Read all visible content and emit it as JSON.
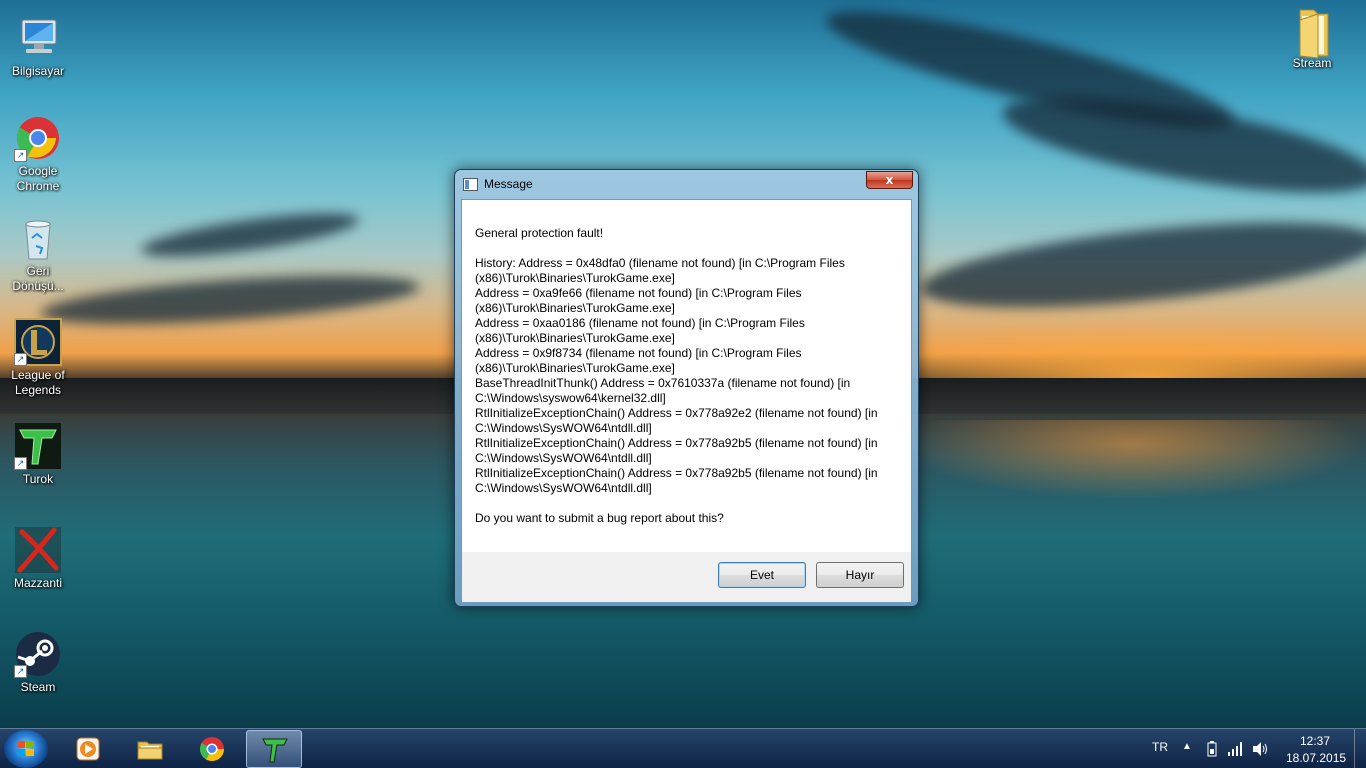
{
  "desktop": {
    "icons_left": [
      {
        "label": "Bilgisayar",
        "icon": "computer-icon"
      },
      {
        "label": "Google Chrome",
        "icon": "chrome-icon"
      },
      {
        "label": "Geri Dönüşü...",
        "icon": "recycle-bin-icon"
      },
      {
        "label": "League of Legends",
        "icon": "league-of-legends-icon"
      },
      {
        "label": "Turok",
        "icon": "turok-icon"
      },
      {
        "label": "Mazzanti",
        "icon": "mazzanti-icon"
      },
      {
        "label": "Steam",
        "icon": "steam-icon"
      }
    ],
    "icons_right": [
      {
        "label": "Stream",
        "icon": "folder-icon"
      }
    ]
  },
  "dialog": {
    "title": "Message",
    "close_label": "x",
    "message_lines": [
      "General protection fault!",
      "",
      "History: Address = 0x48dfa0   (filename not found) [in C:\\Program Files",
      "(x86)\\Turok\\Binaries\\TurokGame.exe]",
      "Address = 0xa9fe66   (filename not found) [in C:\\Program Files",
      "(x86)\\Turok\\Binaries\\TurokGame.exe]",
      "Address = 0xaa0186   (filename not found) [in C:\\Program Files",
      "(x86)\\Turok\\Binaries\\TurokGame.exe]",
      "Address = 0x9f8734   (filename not found) [in C:\\Program Files",
      "(x86)\\Turok\\Binaries\\TurokGame.exe]",
      "BaseThreadInitThunk() Address = 0x7610337a (filename not found) [in",
      "C:\\Windows\\syswow64\\kernel32.dll]",
      "RtlInitializeExceptionChain() Address = 0x778a92e2 (filename not found) [in",
      "C:\\Windows\\SysWOW64\\ntdll.dll]",
      "RtlInitializeExceptionChain() Address = 0x778a92b5 (filename not found) [in",
      "C:\\Windows\\SysWOW64\\ntdll.dll]",
      "RtlInitializeExceptionChain() Address = 0x778a92b5 (filename not found) [in",
      "C:\\Windows\\SysWOW64\\ntdll.dll]",
      "",
      "Do you want to submit a bug report about this?"
    ],
    "buttons": {
      "yes": "Evet",
      "no": "Hayır"
    }
  },
  "taskbar": {
    "pinned": [
      {
        "name": "media-player-icon"
      },
      {
        "name": "file-explorer-icon"
      },
      {
        "name": "chrome-icon"
      },
      {
        "name": "turok-icon",
        "active": true
      }
    ],
    "tray": {
      "language": "TR",
      "time": "12:37",
      "date": "18.07.2015"
    }
  },
  "colors": {
    "taskbar": "#1c3a66",
    "dialog_frame": "#8fb6d6",
    "close_button": "#c9432c"
  }
}
